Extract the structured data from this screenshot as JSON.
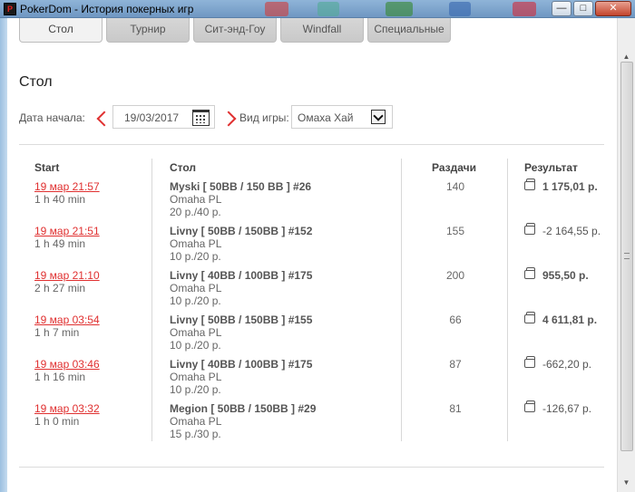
{
  "window": {
    "title": "PokerDom - История покерных игр",
    "icon_text": "P"
  },
  "tabs": [
    {
      "label": "Стол",
      "active": true
    },
    {
      "label": "Турнир",
      "active": false
    },
    {
      "label": "Сит-энд-Гоу",
      "active": false
    },
    {
      "label": "Windfall",
      "active": false
    },
    {
      "label": "Специальные",
      "active": false
    }
  ],
  "section_title": "Стол",
  "filters": {
    "date_label": "Дата начала:",
    "date_value": "19/03/2017",
    "game_label": "Вид игры:",
    "game_value": "Омаха Хай"
  },
  "table": {
    "headers": {
      "start": "Start",
      "table": "Стол",
      "hands": "Раздачи",
      "result": "Результат"
    },
    "rows": [
      {
        "start": "19 мар 21:57",
        "duration": "1 h 40 min",
        "name": "Myski [ 50BB / 150 BB ] #26",
        "game": "Omaha PL",
        "stakes": "20 р./40 р.",
        "hands": "140",
        "result": "1 175,01 р.",
        "bold": true
      },
      {
        "start": "19 мар 21:51",
        "duration": "1 h 49 min",
        "name": "Livny [ 50BB / 150BB ] #152",
        "game": "Omaha PL",
        "stakes": "10 р./20 р.",
        "hands": "155",
        "result": "-2 164,55 р.",
        "bold": false
      },
      {
        "start": "19 мар 21:10",
        "duration": "2 h 27 min",
        "name": "Livny [ 40BB / 100BB ] #175",
        "game": "Omaha PL",
        "stakes": "10 р./20 р.",
        "hands": "200",
        "result": "955,50 р.",
        "bold": true
      },
      {
        "start": "19 мар 03:54",
        "duration": "1 h 7 min",
        "name": "Livny [ 50BB / 150BB ] #155",
        "game": "Omaha PL",
        "stakes": "10 р./20 р.",
        "hands": "66",
        "result": "4 611,81 р.",
        "bold": true
      },
      {
        "start": "19 мар 03:46",
        "duration": "1 h 16 min",
        "name": "Livny [ 40BB / 100BB ] #175",
        "game": "Omaha PL",
        "stakes": "10 р./20 р.",
        "hands": "87",
        "result": "-662,20 р.",
        "bold": false
      },
      {
        "start": "19 мар 03:32",
        "duration": "1 h 0 min",
        "name": "Megion [ 50BB / 150BB ] #29",
        "game": "Omaha PL",
        "stakes": "15 р./30 р.",
        "hands": "81",
        "result": "-126,67 р.",
        "bold": false
      }
    ]
  },
  "colors": {
    "accent_red": "#e03030",
    "tab_bg": "#cccccc",
    "title_bar": "#7fa5cd"
  }
}
